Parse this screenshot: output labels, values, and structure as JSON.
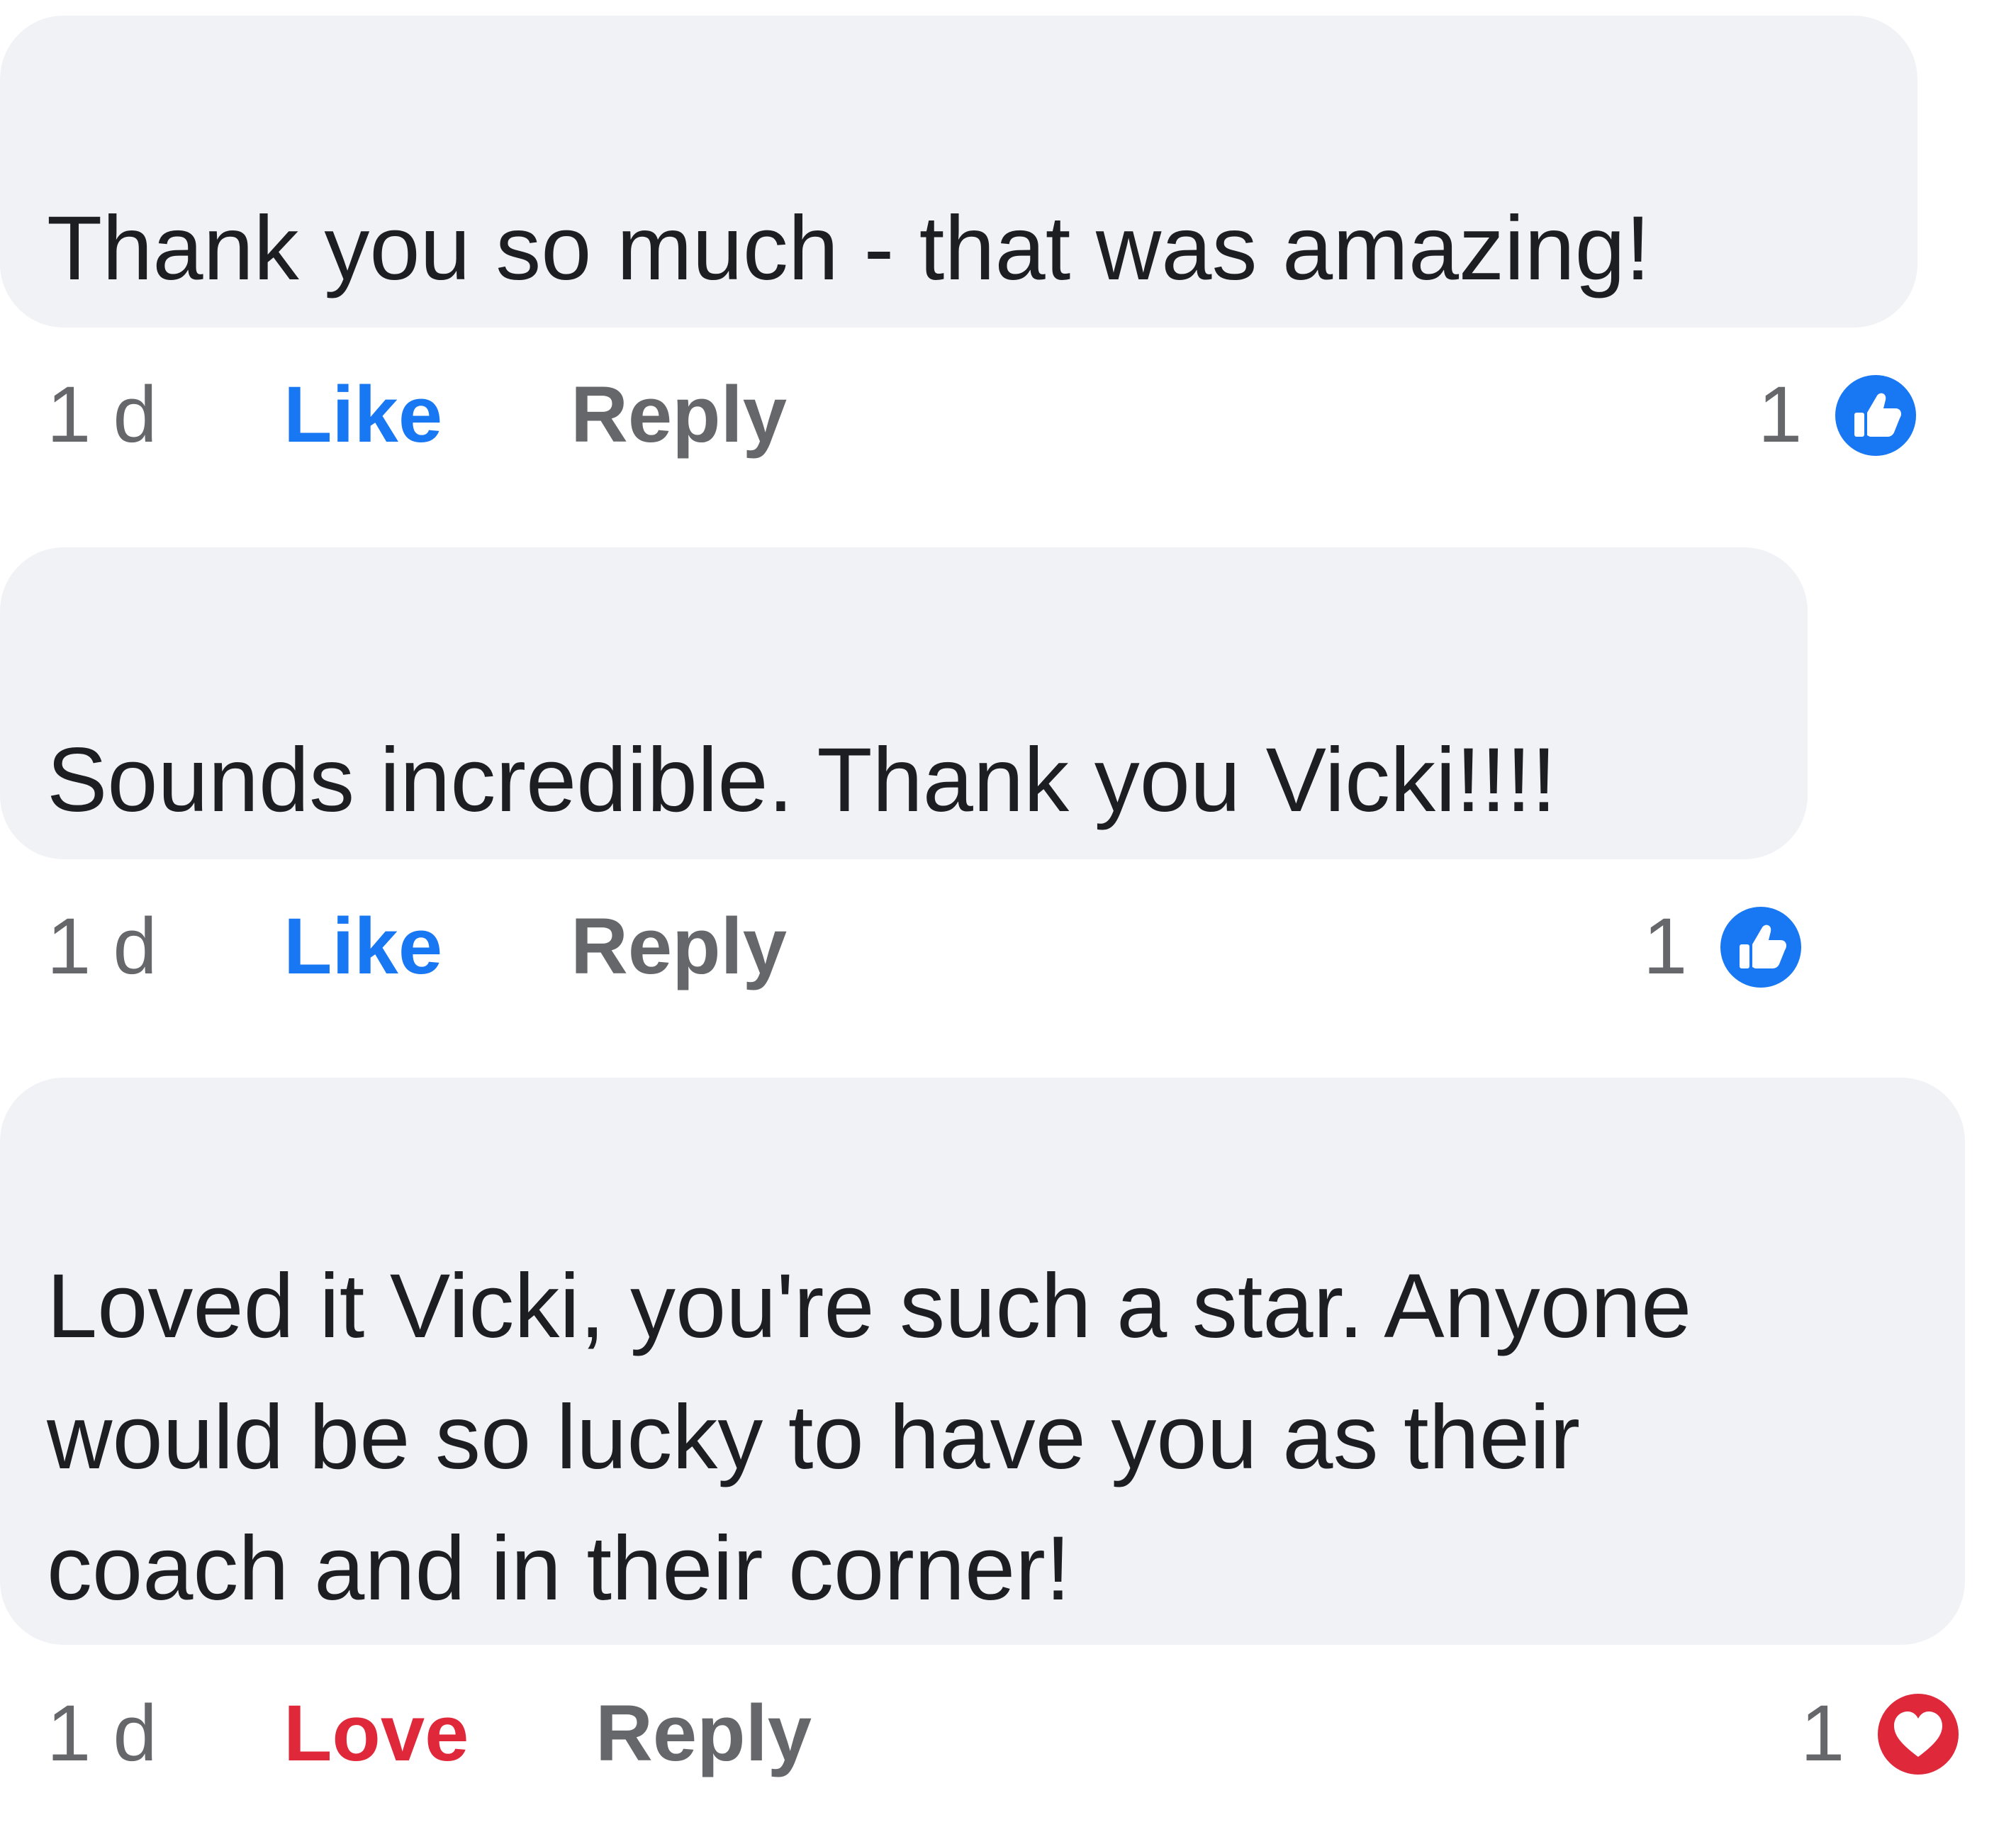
{
  "colors": {
    "bubble": "#f0f2f5",
    "text": "#1c1e21",
    "meta": "#65676b",
    "like": "#1877f2",
    "love": "#e0283b"
  },
  "comments": [
    {
      "text": "Thank you so much - that was amazing!",
      "time": "1 d",
      "primary_action": "Like",
      "reply_label": "Reply",
      "reaction_count": "1",
      "reaction_icon": "like-icon"
    },
    {
      "text": "Sounds incredible. Thank you Vicki!!!!",
      "time": "1 d",
      "primary_action": "Like",
      "reply_label": "Reply",
      "reaction_count": "1",
      "reaction_icon": "like-icon"
    },
    {
      "text": "Loved it Vicki, you're such a star. Anyone\nwould be so lucky to have you as their\ncoach and in their corner!",
      "time": "1 d",
      "primary_action": "Love",
      "reply_label": "Reply",
      "reaction_count": "1",
      "reaction_icon": "love-icon"
    }
  ]
}
